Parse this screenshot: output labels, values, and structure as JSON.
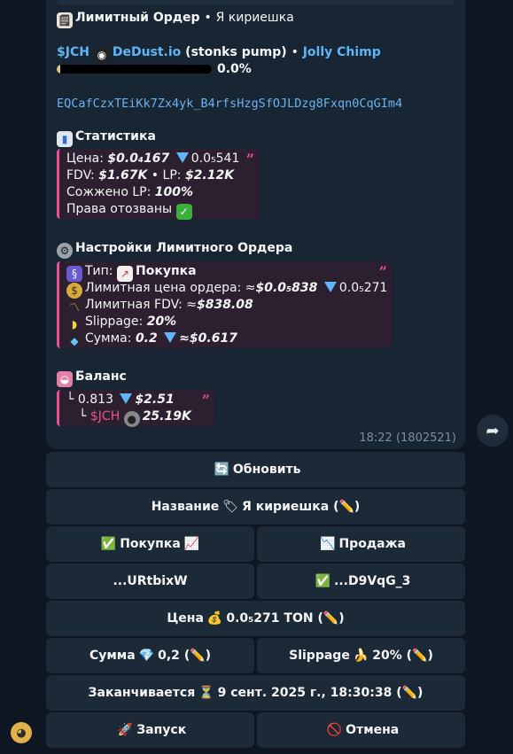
{
  "header": {
    "title_label": "Лимитный Ордер",
    "title_sep": "•",
    "title_name": "Я кириешка"
  },
  "token": {
    "ticker": "$JCH",
    "dex": "DeDust.io",
    "dex_note": "(stonks pump)",
    "sep": "•",
    "name": "Jolly Chimp",
    "progress_percent": 0.0,
    "progress_label": "0.0%",
    "address": "EQCafCzxTEiKk7Zx4yk_B4rfsHzgSfOJLDzg8Fxqn0CqGIm4"
  },
  "stats": {
    "title": "Статистика",
    "price_label": "Цена:",
    "price_usd": "$0.0₄167",
    "price_ton": "0.0₅541",
    "fdv_label": "FDV:",
    "fdv_value": "$1.67K",
    "sep": "•",
    "lp_label": "LP:",
    "lp_value": "$2.12K",
    "burned_label": "Сожжено LP:",
    "burned_value": "100%",
    "revoked_label": "Права отозваны"
  },
  "settings": {
    "title": "Настройки Лимитного Ордера",
    "type_label": "Тип:",
    "type_value": "Покупка",
    "limit_price_label": "Лимитная цена ордера: ≈",
    "limit_price_usd": "$0.0₅838",
    "limit_price_ton": "0.0₅271",
    "limit_fdv_label": "Лимитная FDV: ≈",
    "limit_fdv_value": "$838.08",
    "slippage_label": "Slippage:",
    "slippage_value": "20%",
    "amount_label": "Сумма:",
    "amount_value": "0.2",
    "amount_usd": "≈$0.617"
  },
  "balance": {
    "title": "Баланс",
    "ton_amount": "0.813",
    "ton_usd": "$2.51",
    "token_ticker": "$JCH",
    "token_amount": "25.19K"
  },
  "message_time": "18:22 (1802521)",
  "buttons": {
    "refresh": "Обновить",
    "name": "Название",
    "name_value": "Я кириешка",
    "edit": "(✏️)",
    "buy": "Покупка",
    "sell": "Продажа",
    "wallet1": "...URtbixW",
    "wallet2": "...D9VqG_3",
    "price": "Цена",
    "price_value": "0.0₅271 TON",
    "amount": "Сумма",
    "amount_value": "0,2",
    "slippage": "Slippage",
    "slippage_value": "20%",
    "expires": "Заканчивается",
    "expires_value": "9 сент. 2025 г., 18:30:38",
    "launch": "Запуск",
    "cancel": "Отмена"
  },
  "colors": {
    "accent": "#5eb5f7",
    "quote": "#e8538f",
    "bg": "#0e1621",
    "bubble": "#182533",
    "button": "#1c2a38"
  }
}
